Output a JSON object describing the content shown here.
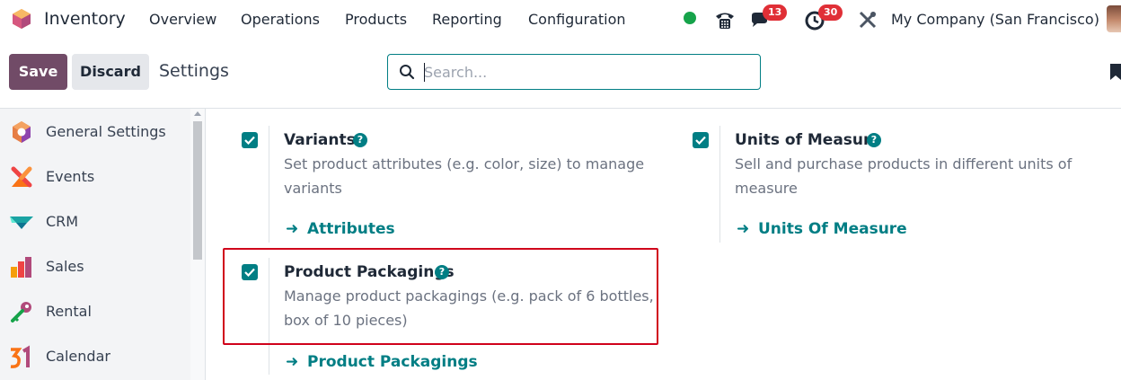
{
  "app": {
    "name": "Inventory",
    "logo_icon": "odoo-inventory-icon",
    "brand_color": "#714b67",
    "accent_color": "#017e84"
  },
  "menu": [
    {
      "label": "Overview"
    },
    {
      "label": "Operations"
    },
    {
      "label": "Products"
    },
    {
      "label": "Reporting"
    },
    {
      "label": "Configuration"
    }
  ],
  "systray": {
    "presence": "online",
    "phone_icon": "phone-icon",
    "messages_icon": "chat-icon",
    "messages_count": "13",
    "activities_icon": "clock-icon",
    "activities_count": "30",
    "tools_icon": "tools-icon",
    "company": "My Company (San Francisco)"
  },
  "control_panel": {
    "save_label": "Save",
    "discard_label": "Discard",
    "breadcrumb": "Settings",
    "search_placeholder": "Search...",
    "search_value": ""
  },
  "sidebar": {
    "items": [
      {
        "label": "General Settings",
        "icon": "settings-hexagon-icon"
      },
      {
        "label": "Events",
        "icon": "events-icon"
      },
      {
        "label": "CRM",
        "icon": "crm-icon"
      },
      {
        "label": "Sales",
        "icon": "sales-icon"
      },
      {
        "label": "Rental",
        "icon": "rental-key-icon"
      },
      {
        "label": "Calendar",
        "icon": "calendar-icon"
      }
    ]
  },
  "settings": [
    {
      "title": "Variants",
      "checked": true,
      "description": "Set product attributes (e.g. color, size) to manage variants",
      "link": "Attributes"
    },
    {
      "title": "Units of Measure",
      "checked": true,
      "description": "Sell and purchase products in different units of measure",
      "link": "Units Of Measure"
    },
    {
      "title": "Product Packagings",
      "checked": true,
      "description": "Manage product packagings (e.g. pack of 6 bottles, box of 10 pieces)",
      "link": "Product Packagings"
    }
  ],
  "highlight_color": "#d0021b"
}
